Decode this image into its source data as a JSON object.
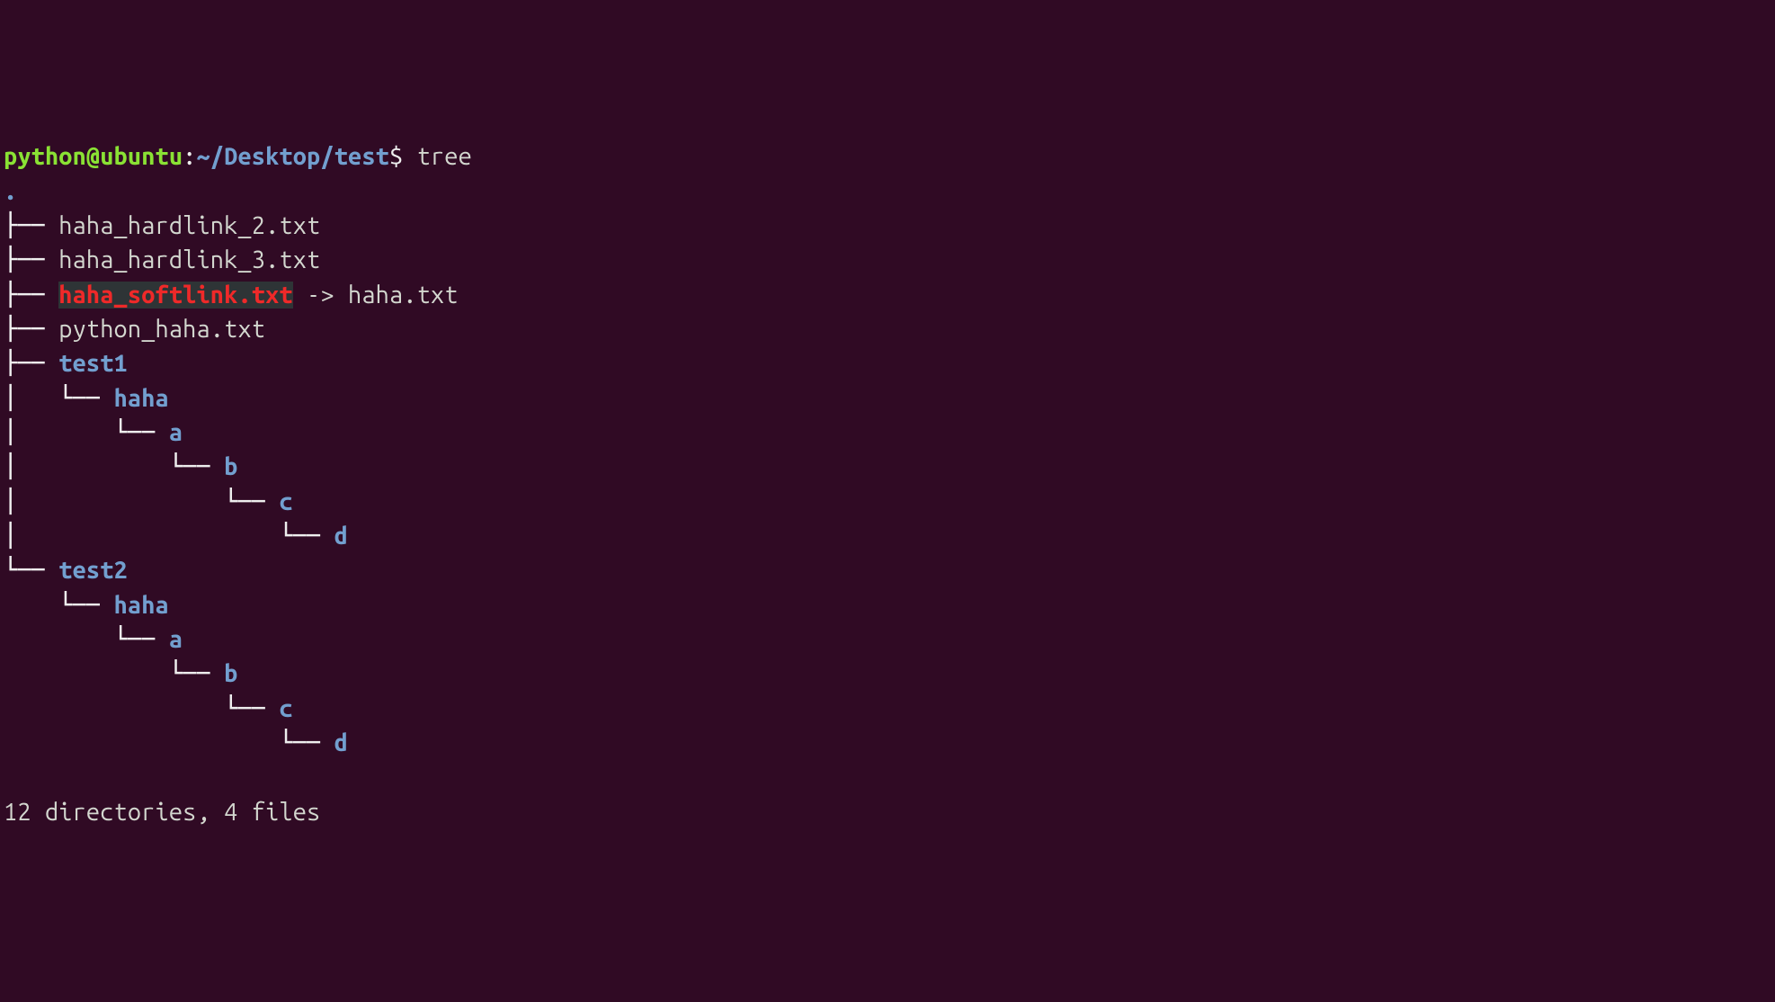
{
  "prompt": {
    "user": "python@ubuntu",
    "sep": ":",
    "path": "~/Desktop/test",
    "sigil": "$",
    "cmd": "tree"
  },
  "tree": {
    "root": ".",
    "lines": [
      {
        "prefix": "├── ",
        "type": "file",
        "name": "haha_hardlink_2.txt"
      },
      {
        "prefix": "├── ",
        "type": "file",
        "name": "haha_hardlink_3.txt"
      },
      {
        "prefix": "├── ",
        "type": "brokenlink",
        "name": "haha_softlink.txt",
        "arrow": " -> ",
        "target": "haha.txt"
      },
      {
        "prefix": "├── ",
        "type": "file",
        "name": "python_haha.txt"
      },
      {
        "prefix": "├── ",
        "type": "dir",
        "name": "test1"
      },
      {
        "prefix": "│   └── ",
        "type": "dir",
        "name": "haha"
      },
      {
        "prefix": "│       └── ",
        "type": "dir",
        "name": "a"
      },
      {
        "prefix": "│           └── ",
        "type": "dir",
        "name": "b"
      },
      {
        "prefix": "│               └── ",
        "type": "dir",
        "name": "c"
      },
      {
        "prefix": "│                   └── ",
        "type": "dir",
        "name": "d"
      },
      {
        "prefix": "└── ",
        "type": "dir",
        "name": "test2"
      },
      {
        "prefix": "    └── ",
        "type": "dir",
        "name": "haha"
      },
      {
        "prefix": "        └── ",
        "type": "dir",
        "name": "a"
      },
      {
        "prefix": "            └── ",
        "type": "dir",
        "name": "b"
      },
      {
        "prefix": "                └── ",
        "type": "dir",
        "name": "c"
      },
      {
        "prefix": "                    └── ",
        "type": "dir",
        "name": "d"
      }
    ]
  },
  "summary": "12 directories, 4 files"
}
